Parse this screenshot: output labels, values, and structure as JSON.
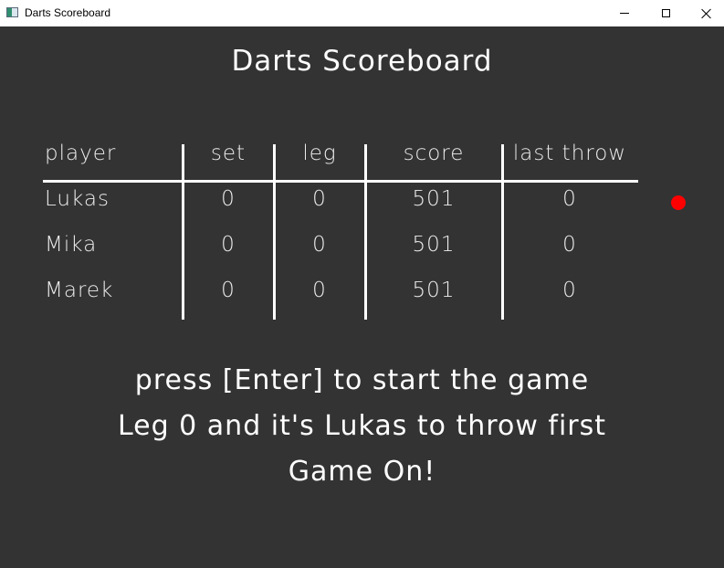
{
  "window": {
    "title": "Darts Scoreboard"
  },
  "scoreboard": {
    "title": "Darts Scoreboard",
    "columns": [
      "player",
      "set",
      "leg",
      "score",
      "last throw"
    ],
    "rows": [
      {
        "player": "Lukas",
        "set": "0",
        "leg": "0",
        "score": "501",
        "last_throw": "0"
      },
      {
        "player": "Mika",
        "set": "0",
        "leg": "0",
        "score": "501",
        "last_throw": "0"
      },
      {
        "player": "Marek",
        "set": "0",
        "leg": "0",
        "score": "501",
        "last_throw": "0"
      }
    ],
    "active_player_indicator_color": "#ff0000"
  },
  "messages": {
    "line1": "press [Enter] to start the game",
    "line2": "Leg 0 and it's Lukas to throw first",
    "line3": "Game On!"
  },
  "colors": {
    "background": "#333333",
    "text": "#ffffff"
  },
  "icons": {
    "app": "app-icon",
    "minimize": "minimize-icon",
    "maximize": "maximize-icon",
    "close": "close-icon"
  }
}
